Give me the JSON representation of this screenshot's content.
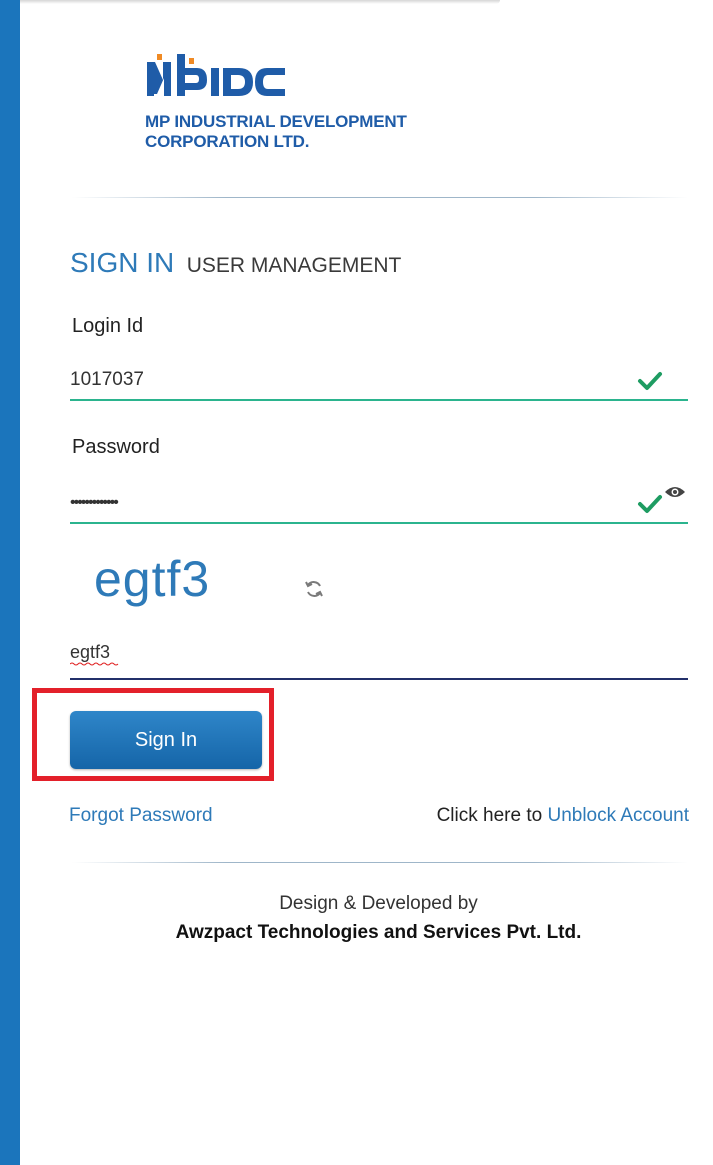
{
  "logo": {
    "mark_text": "MPIDC",
    "line1": "MP INDUSTRIAL DEVELOPMENT",
    "line2": "CORPORATION LTD."
  },
  "heading": {
    "primary": "SIGN IN",
    "secondary": "USER MANAGEMENT"
  },
  "login": {
    "label": "Login Id",
    "value": "1017037"
  },
  "password": {
    "label": "Password",
    "value": "•••••••••••••"
  },
  "captcha": {
    "image_text": "egtf3",
    "input_value": "egtf3"
  },
  "buttons": {
    "sign_in": "Sign In"
  },
  "links": {
    "forgot_password": "Forgot Password",
    "unblock_prefix": "Click here to",
    "unblock_link": "Unblock Account"
  },
  "footer": {
    "line1": "Design & Developed by",
    "line2": "Awzpact Technologies and Services Pvt. Ltd."
  },
  "colors": {
    "brand_blue": "#1b75bc",
    "accent_green": "#2bb48e",
    "highlight_red": "#e3202a"
  },
  "icons": [
    "check-icon",
    "eye-icon",
    "refresh-icon"
  ]
}
